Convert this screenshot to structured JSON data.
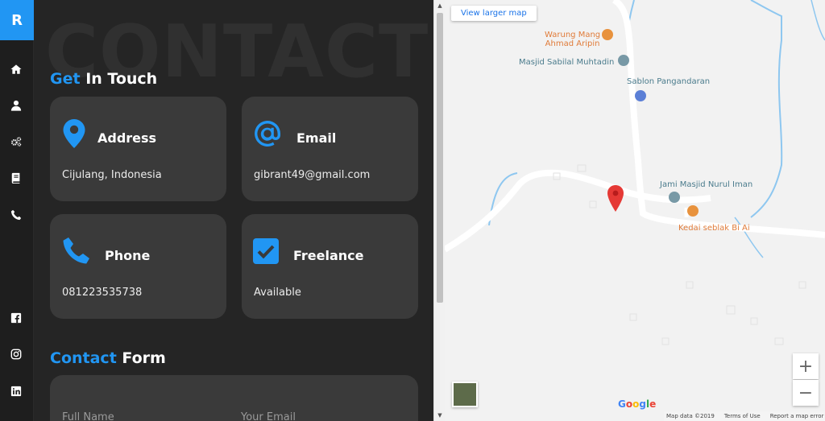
{
  "brand": {
    "logo_letter": "R"
  },
  "sidebar": {
    "nav": [
      {
        "name": "home",
        "icon": "home-icon"
      },
      {
        "name": "about",
        "icon": "user-icon"
      },
      {
        "name": "services",
        "icon": "gears-icon"
      },
      {
        "name": "portfolio",
        "icon": "book-icon"
      },
      {
        "name": "contact",
        "icon": "phone-icon"
      }
    ],
    "social": [
      {
        "name": "facebook",
        "icon": "facebook-icon"
      },
      {
        "name": "instagram",
        "icon": "instagram-icon"
      },
      {
        "name": "linkedin",
        "icon": "linkedin-icon"
      }
    ]
  },
  "contact": {
    "bg_word": "CONTACT",
    "get_in_touch": {
      "accent": "Get",
      "rest": " In Touch"
    },
    "cards": [
      {
        "title": "Address",
        "value": "Cijulang, Indonesia",
        "icon": "map-pin-icon"
      },
      {
        "title": "Email",
        "value": "gibrant49@gmail.com",
        "icon": "at-icon"
      },
      {
        "title": "Phone",
        "value": "081223535738",
        "icon": "phone-icon"
      },
      {
        "title": "Freelance",
        "value": "Available",
        "icon": "checkbox-icon"
      }
    ],
    "form_heading": {
      "accent": "Contact",
      "rest": " Form"
    },
    "form": {
      "name_placeholder": "Full Name",
      "email_placeholder": "Your Email"
    }
  },
  "map": {
    "larger_map_label": "View larger map",
    "pois": [
      {
        "label": "Warung Mang Ahmad Aripin",
        "line1": "Warung Mang",
        "line2": "Ahmad Aripin",
        "color": "orange"
      },
      {
        "label": "Masjid Sabilal Muhtadin",
        "color": "teal"
      },
      {
        "label": "Sablon Pangandaran",
        "color": "teal"
      },
      {
        "label": "Jami Masjid Nurul Iman",
        "color": "teal"
      },
      {
        "label": "Kedai seblak Bi Ai",
        "color": "orange"
      }
    ],
    "zoom_in": "+",
    "zoom_out": "−",
    "google": "Google",
    "attribution": {
      "data": "Map data ©2019",
      "terms": "Terms of Use",
      "report": "Report a map error"
    }
  },
  "colors": {
    "accent": "#2196f3",
    "card": "#3a3a3a",
    "panel": "#252525"
  }
}
